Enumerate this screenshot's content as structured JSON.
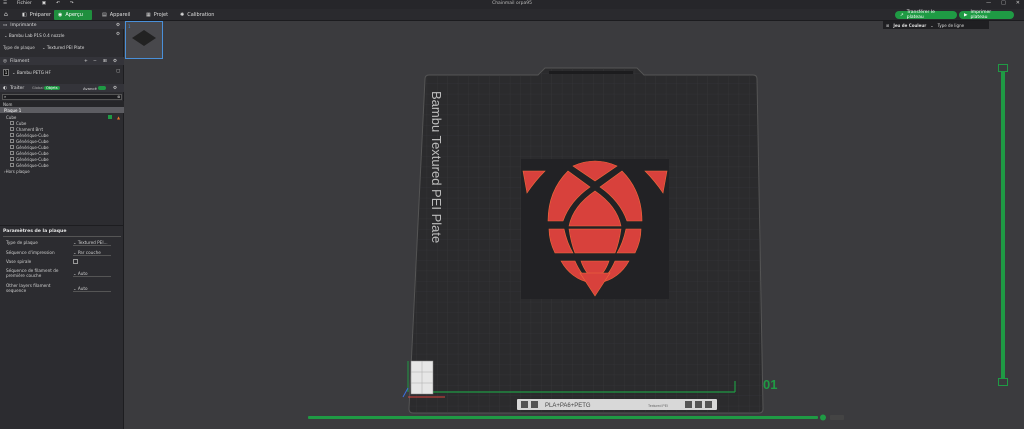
{
  "titlebar": {
    "menu_label": "Fichier",
    "window_title": "Chainmail orpa95",
    "controls": [
      "—",
      "□",
      "✕"
    ]
  },
  "tabs": [
    {
      "label": "Préparer",
      "icon": "cube-icon",
      "active": false
    },
    {
      "label": "Aperçu",
      "icon": "eye-icon",
      "active": true
    },
    {
      "label": "Appareil",
      "icon": "device-icon",
      "active": false
    },
    {
      "label": "Projet",
      "icon": "project-icon",
      "active": false
    },
    {
      "label": "Calibration",
      "icon": "calibration-icon",
      "active": false
    }
  ],
  "header_buttons": {
    "send": "Transférer le plateau",
    "print": "Imprimer plateau"
  },
  "hint": {
    "color_scheme": "Jeu de Couleur",
    "line_type": "Type de ligne"
  },
  "sidebar": {
    "printer_section": "Imprimante",
    "printer_name": "Bambu Lab P1S 0.4 nozzle",
    "plate_type_label": "Type de plaque",
    "plate_type_value": "Textured PEI Plate",
    "filament_section": "Filament",
    "filament_index": "1",
    "filament_name": "Bambu PETG HF",
    "processor_section": "Traiter",
    "mode_global": "Global",
    "mode_objects": "Objets",
    "mode_advanced": "Avancé",
    "search_placeholder": "",
    "tree_header": "Nom",
    "tree": [
      {
        "label": "Plaque 1",
        "indent": 4,
        "selected": true
      },
      {
        "label": "Cube",
        "indent": 6,
        "selected": false
      },
      {
        "label": "Cube",
        "indent": 14,
        "selected": false
      },
      {
        "label": "Chamerd Brrt",
        "indent": 14,
        "selected": false
      },
      {
        "label": "Générique-Cube",
        "indent": 14,
        "selected": false
      },
      {
        "label": "Générique-Cube",
        "indent": 14,
        "selected": false
      },
      {
        "label": "Générique-Cube",
        "indent": 14,
        "selected": false
      },
      {
        "label": "Générique-Cube",
        "indent": 14,
        "selected": false
      },
      {
        "label": "Générique-Cube",
        "indent": 14,
        "selected": false
      },
      {
        "label": "Générique-Cube",
        "indent": 14,
        "selected": false
      },
      {
        "label": "Hors plaque",
        "indent": 4,
        "selected": false
      }
    ],
    "params_title": "Paramètres de la plaque",
    "params": [
      {
        "label": "Type de plaque",
        "value": "Textured PEI..."
      },
      {
        "label": "Séquence d'impression",
        "value": "Par couche"
      },
      {
        "label": "Vase spirale",
        "value": ""
      },
      {
        "label": "Séquence de filament de",
        "label2": "première couche",
        "value": "Auto"
      },
      {
        "label": "Other layers filament",
        "label2": "sequence",
        "value": "Auto"
      }
    ]
  },
  "plate": {
    "label": "Bambu Textured PEI Plate",
    "number": "01",
    "badge_text": "PLA+PA6+PETG",
    "badge_sub": "Textured PEI"
  },
  "colors": {
    "accent": "#1f9a44",
    "plate": "#2b2b2d",
    "model_red": "#d8413c",
    "model_base": "#222225"
  }
}
